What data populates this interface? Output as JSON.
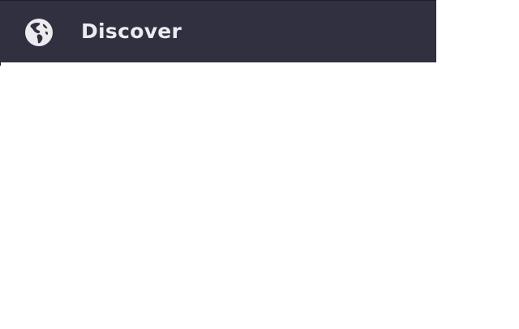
{
  "nav": {
    "item": {
      "icon": "globe-icon",
      "label": "Discover"
    }
  },
  "colors": {
    "bar_background": "#313040",
    "text": "#ecebf0",
    "page_background": "#ffffff"
  }
}
